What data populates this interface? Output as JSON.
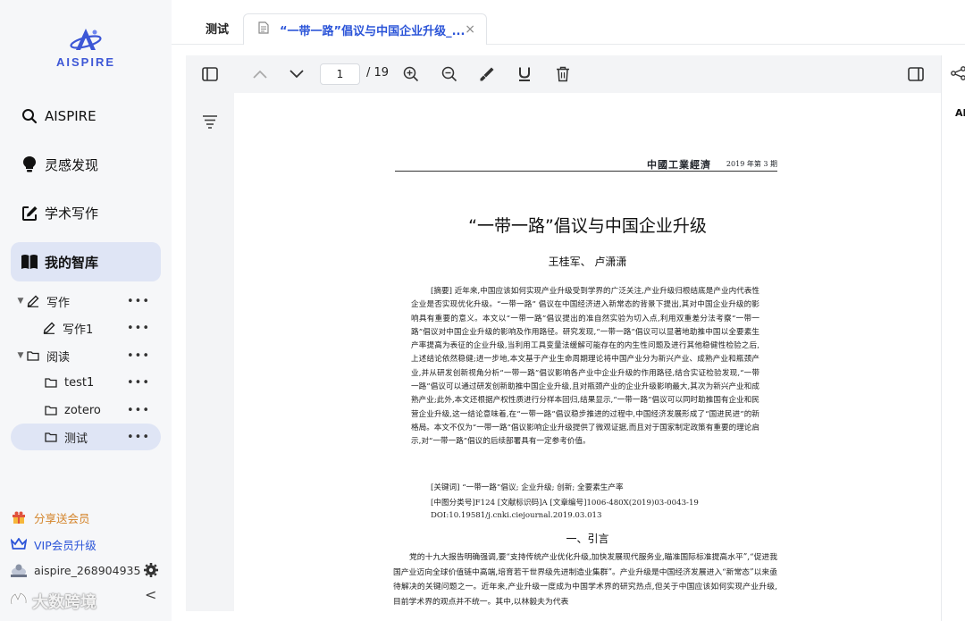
{
  "app": {
    "logo_text": "AISPIRE",
    "accent": "#3d57d6"
  },
  "sidebar": {
    "nav": [
      {
        "label": "AISPIRE",
        "icon": "search-icon"
      },
      {
        "label": "灵感发现",
        "icon": "lightbulb-icon"
      },
      {
        "label": "学术写作",
        "icon": "edit-icon"
      },
      {
        "label": "我的智库",
        "icon": "book-icon"
      }
    ],
    "tree": [
      {
        "label": "写作",
        "icon": "pen-icon",
        "level": 0,
        "expanded": true
      },
      {
        "label": "写作1",
        "icon": "pen-icon",
        "level": 1
      },
      {
        "label": "阅读",
        "icon": "folder-icon",
        "level": 0,
        "expanded": true
      },
      {
        "label": "test1",
        "icon": "folder-icon",
        "level": 1
      },
      {
        "label": "zotero",
        "icon": "folder-icon",
        "level": 1
      },
      {
        "label": "测试",
        "icon": "folder-icon",
        "level": 1,
        "selected": true
      }
    ],
    "more": "•••",
    "share_label": "分享送会员",
    "vip_label": "VIP会员升级",
    "username": "aispire_268904935",
    "collapse": "<"
  },
  "watermark": "大数跨境",
  "tabs": {
    "plain": "测试",
    "active": "“一带一路”倡议与中国企业升级_...",
    "close": "×"
  },
  "toolbar": {
    "page": "1",
    "total": "/ 19"
  },
  "right_rail": {
    "tag": "AI"
  },
  "document": {
    "journal_name": "中國工業經濟",
    "journal_issue": "2019 年第 3 期",
    "title": "“一带一路”倡议与中国企业升级",
    "authors": "王桂军、 卢潇潇",
    "abstract": "[摘要] 近年来,中国应该如何实现产业升级受到学界的广泛关注,产业升级归根结底是产业内代表性企业是否实现优化升级。“一带一路” 倡议在中国经济进入新常态的背景下提出,其对中国企业升级的影响具有重要的意义。本文以“一带一路”倡议提出的准自然实验为切入点,利用双重差分法考察“一带一路”倡议对中国企业升级的影响及作用路径。研究发现,“一带一路”倡议可以显著地助推中国以全要素生产率提高为表征的企业升级,当利用工具变量法缓解可能存在的内生性问题及进行其他稳健性检验之后,上述结论依然稳健;进一步地,本文基于产业生命周期理论将中国产业分为新兴产业、成熟产业和瓶颈产业,并从研发创新视角分析“一带一路”倡议影响各产业中企业升级的作用路径,结合实证检验发现,“一带一路”倡议可以通过研发创新助推中国企业升级,且对瓶颈产业的企业升级影响最大,其次为新兴产业和成熟产业;此外,本文还根据产权性质进行分样本回归,结果显示,“一带一路”倡议可以同时助推国有企业和民营企业升级,这一结论意味着,在“一带一路”倡议稳步推进的过程中,中国经济发展形成了“国进民进”的新格局。本文不仅为“一带一路”倡议影响企业升级提供了微观证据,而且对于国家制定政策有重要的理论启示,对“一带一路”倡议的后续部署具有一定参考价值。",
    "keywords": "[关键词]  “一带一路”倡议;  企业升级;  创新;  全要素生产率",
    "classification": "[中图分类号]F124   [文献标识码]A   [文章编号]1006-480X(2019)03-0043-19",
    "doi": "DOI:10.19581/j.cnki.ciejournal.2019.03.013",
    "section_title": "一、引言",
    "body": "党的十九大报告明确强调,要“支持传统产业优化升级,加快发展现代服务业,瞄准国际标准提高水平”,“促进我国产业迈向全球价值链中高端,培育若干世界级先进制造业集群”。产业升级是中国经济发展进入“新常态”以来亟待解决的关键问题之一。近年来,产业升级一度成为中国学术界的研究热点,但关于中国应该如何实现产业升级,目前学术界的观点并不统一。其中,以林毅夫为代表"
  }
}
